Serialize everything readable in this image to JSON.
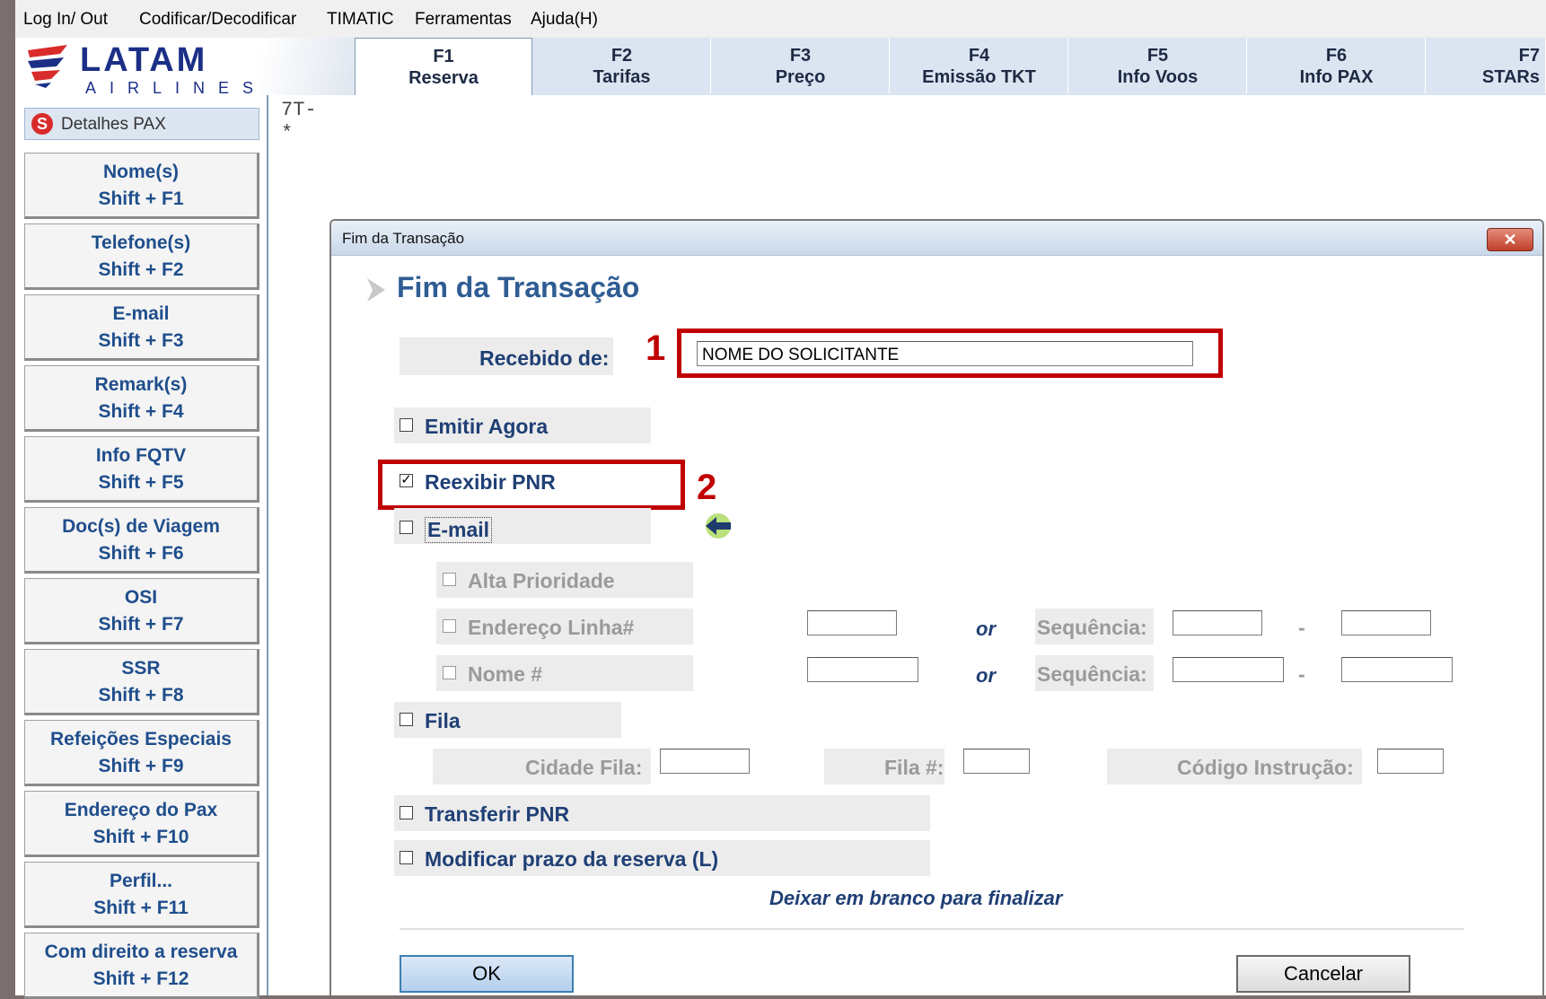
{
  "menu": [
    "Log In/ Out",
    "Codificar/Decodificar",
    "TIMATIC",
    "Ferramentas",
    "Ajuda(H)"
  ],
  "logo": {
    "word": "LATAM",
    "sub": "AIRLINES"
  },
  "tabs": [
    {
      "key": "F1",
      "label": "Reserva"
    },
    {
      "key": "F2",
      "label": "Tarifas"
    },
    {
      "key": "F3",
      "label": "Preço"
    },
    {
      "key": "F4",
      "label": "Emissão TKT"
    },
    {
      "key": "F5",
      "label": "Info Voos"
    },
    {
      "key": "F6",
      "label": "Info PAX"
    },
    {
      "key": "F7",
      "label": "STARs"
    }
  ],
  "sidebar": {
    "header": "Detalhes PAX",
    "header_icon": "S",
    "items": [
      {
        "label": "Nome(s)",
        "shortcut": "Shift + F1"
      },
      {
        "label": "Telefone(s)",
        "shortcut": "Shift + F2"
      },
      {
        "label": "E-mail",
        "shortcut": "Shift + F3"
      },
      {
        "label": "Remark(s)",
        "shortcut": "Shift + F4"
      },
      {
        "label": "Info FQTV",
        "shortcut": "Shift + F5"
      },
      {
        "label": "Doc(s) de Viagem",
        "shortcut": "Shift + F6"
      },
      {
        "label": "OSI",
        "shortcut": "Shift + F7"
      },
      {
        "label": "SSR",
        "shortcut": "Shift + F8"
      },
      {
        "label": "Refeições Especiais",
        "shortcut": "Shift + F9"
      },
      {
        "label": "Endereço do Pax",
        "shortcut": "Shift + F10"
      },
      {
        "label": "Perfil...",
        "shortcut": "Shift + F11"
      },
      {
        "label": "Com direito a reserva",
        "shortcut": "Shift + F12"
      }
    ]
  },
  "terminal": {
    "line1": "7T-",
    "line2": "*"
  },
  "dialog": {
    "window_title": "Fim da Transação",
    "close_glyph": "✕",
    "heading": "Fim da Transação",
    "recebido_label": "Recebido de:",
    "recebido_value": "NOME DO SOLICITANTE",
    "emitir_agora": {
      "label": "Emitir Agora",
      "checked": false
    },
    "reexibir_pnr": {
      "label": "Reexibir PNR",
      "checked": true
    },
    "email": {
      "label": "E-mail",
      "checked": false
    },
    "alta_prioridade": "Alta Prioridade",
    "endereco_linha": "Endereço Linha#",
    "nome_num": "Nome #",
    "or": "or",
    "sequencia": "Sequência:",
    "dash": "-",
    "fila": "Fila",
    "cidade_fila": "Cidade Fila:",
    "fila_num": "Fila #:",
    "codigo_instrucao": "Código Instrução:",
    "transferir_pnr": "Transferir PNR",
    "modificar_prazo": "Modificar prazo da reserva (L)",
    "hint": "Deixar em branco para finalizar",
    "ok": "OK",
    "cancel": "Cancelar"
  },
  "annotations": {
    "n1": "1",
    "n2": "2",
    "color": "#c00000"
  },
  "colors": {
    "label_blue": "#1f3f75",
    "sidebar_text": "#1f4e8c",
    "logo_blue": "#1b2f86"
  }
}
